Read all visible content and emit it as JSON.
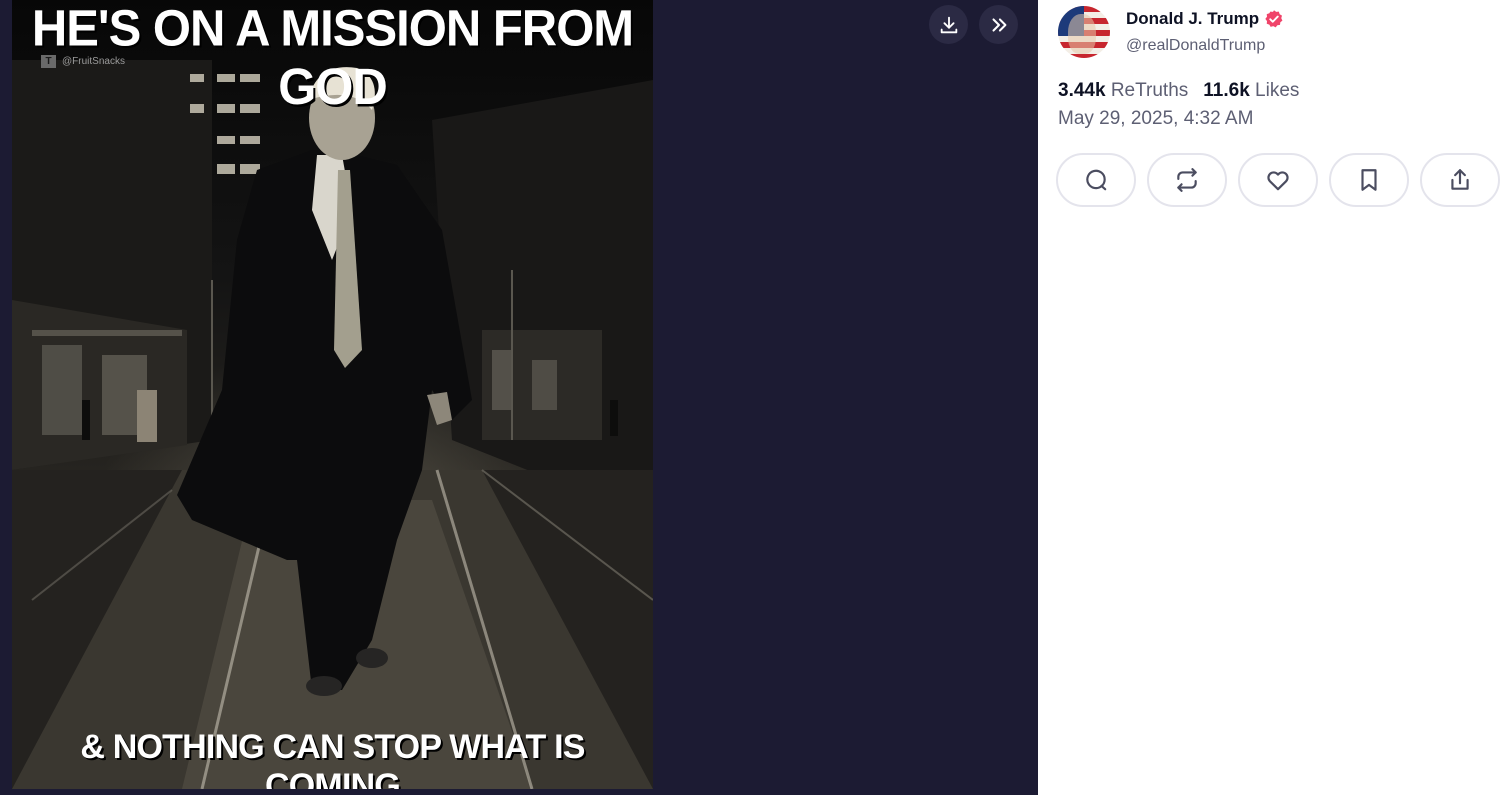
{
  "meme": {
    "top_caption": "HE'S ON A MISSION FROM GOD",
    "bottom_caption": "& NOTHING CAN STOP WHAT IS COMING",
    "watermark": "@FruitSnacks"
  },
  "viewer": {
    "download_icon": "download-icon",
    "collapse_icon": "double-chevron-right-icon"
  },
  "post": {
    "author": {
      "display_name": "Donald J. Trump",
      "handle": "@realDonaldTrump",
      "verified_icon": "verified-badge-icon"
    },
    "stats": {
      "retruths_count": "3.44k",
      "retruths_label": "ReTruths",
      "likes_count": "11.6k",
      "likes_label": "Likes"
    },
    "timestamp": "May 29, 2025, 4:32 AM",
    "actions": [
      "reply-icon",
      "retruth-icon",
      "like-icon",
      "bookmark-icon",
      "share-icon"
    ]
  },
  "colors": {
    "viewer_bg": "#1c1b33",
    "text_primary": "#0e1224",
    "text_secondary": "#5d5f73",
    "verified": "#f0446a",
    "button_border": "#e4e4ec"
  }
}
